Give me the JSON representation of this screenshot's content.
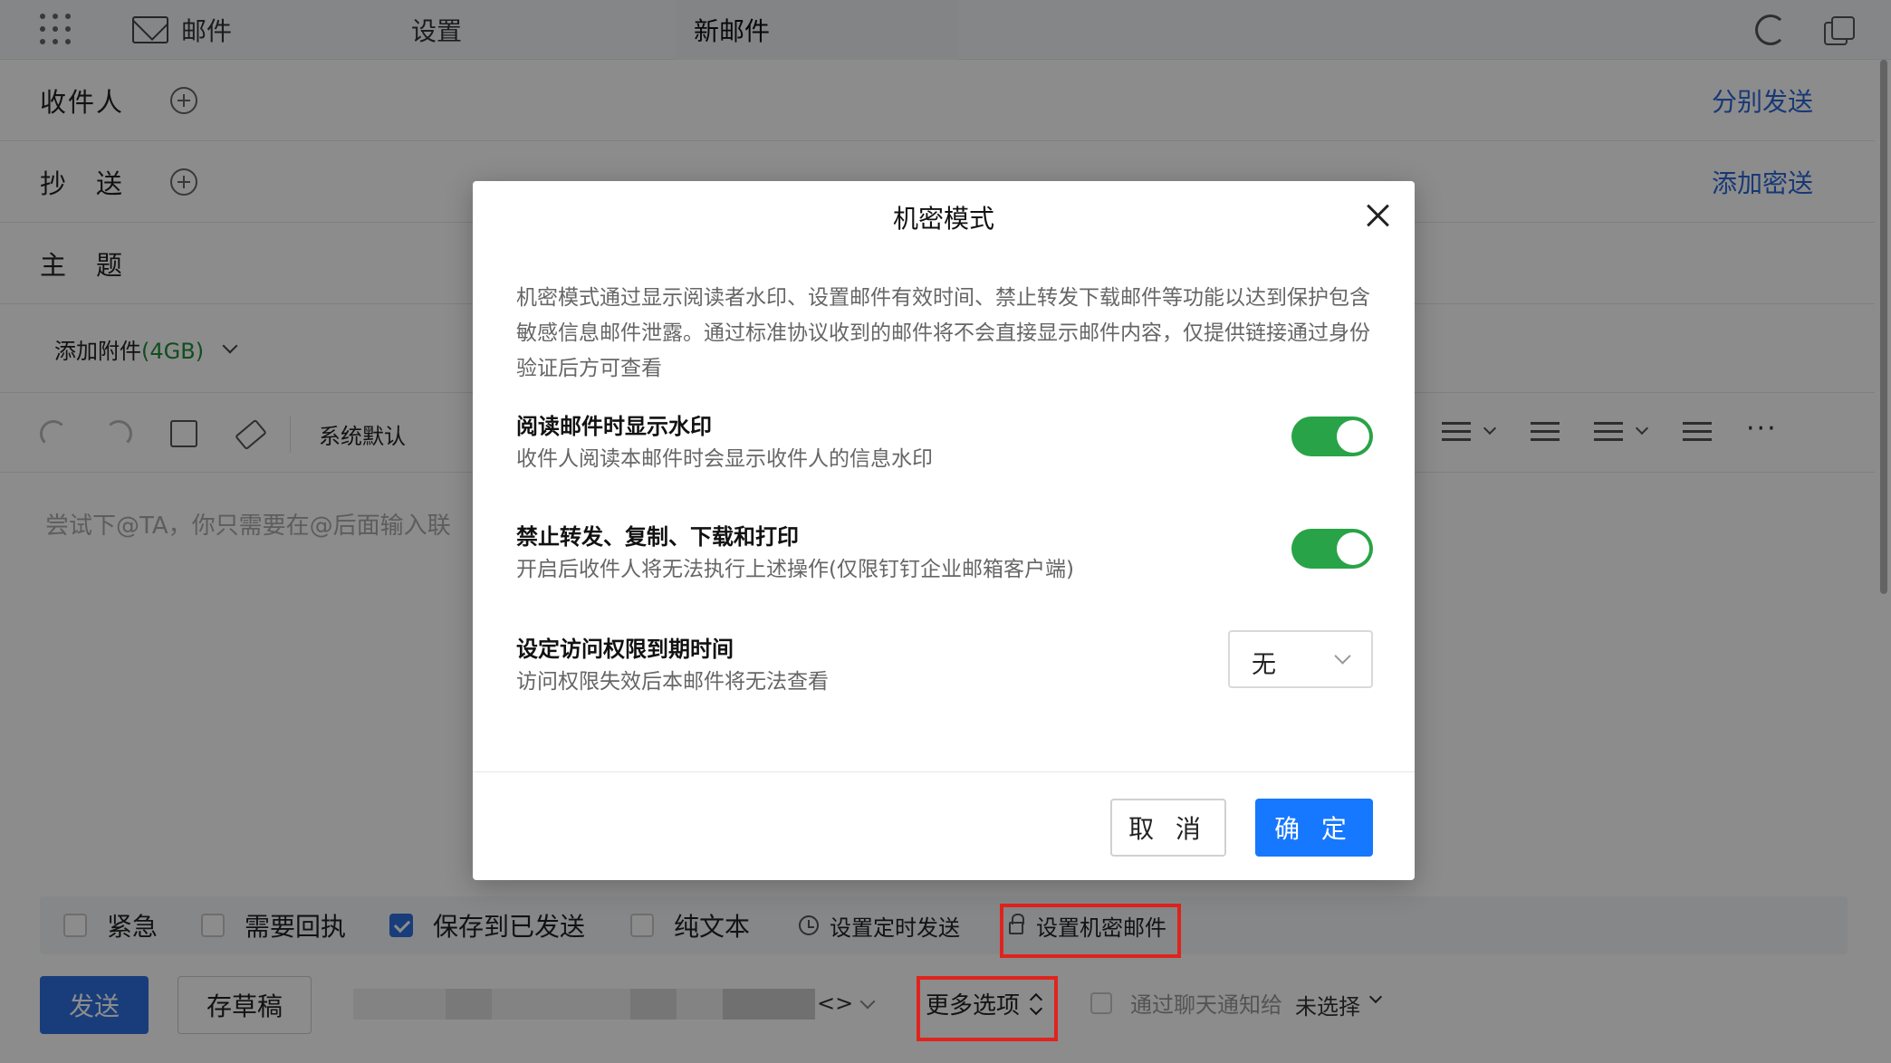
{
  "topbar": {
    "tabs": [
      {
        "label": "邮件",
        "icon": "mail-icon"
      },
      {
        "label": "设置"
      },
      {
        "label": "新邮件"
      }
    ],
    "icons": [
      "apps-grid-icon",
      "refresh-icon",
      "popout-window-icon"
    ]
  },
  "compose": {
    "to_label": "收件人",
    "separate_send": "分别发送",
    "cc_label": "抄　送",
    "add_bcc": "添加密送",
    "subject_label": "主　题",
    "attach_label": "添加附件",
    "attach_size": "(4GB)",
    "font_default": "系统默认",
    "editor_placeholder": "尝试下@TA，你只需要在@后面输入联"
  },
  "options": {
    "urgent": {
      "label": "紧急",
      "checked": false
    },
    "receipt": {
      "label": "需要回执",
      "checked": false
    },
    "save_sent": {
      "label": "保存到已发送",
      "checked": true
    },
    "plain_text": {
      "label": "纯文本",
      "checked": false
    },
    "schedule": "设置定时发送",
    "confidential": "设置机密邮件"
  },
  "bottom": {
    "send": "发送",
    "draft": "存草稿",
    "sender_tail": "<>",
    "more_options": "更多选项",
    "notify_label": "通过聊天通知给",
    "notify_value": "未选择"
  },
  "modal": {
    "title": "机密模式",
    "description": "机密模式通过显示阅读者水印、设置邮件有效时间、禁止转发下载邮件等功能以达到保护包含敏感信息邮件泄露。通过标准协议收到的邮件将不会直接显示邮件内容，仅提供链接通过身份验证后方可查看",
    "settings": [
      {
        "title": "阅读邮件时显示水印",
        "subtitle": "收件人阅读本邮件时会显示收件人的信息水印",
        "enabled": true
      },
      {
        "title": "禁止转发、复制、下载和打印",
        "subtitle": "开启后收件人将无法执行上述操作(仅限钉钉企业邮箱客户端)",
        "enabled": true
      },
      {
        "title": "设定访问权限到期时间",
        "subtitle": "访问权限失效后本邮件将无法查看",
        "value": "无"
      }
    ],
    "cancel": "取 消",
    "confirm": "确 定"
  },
  "colors": {
    "primary": "#1677ff",
    "toggle_on": "#29a347",
    "highlight_box": "#e0231d",
    "link": "#2a67d6"
  }
}
